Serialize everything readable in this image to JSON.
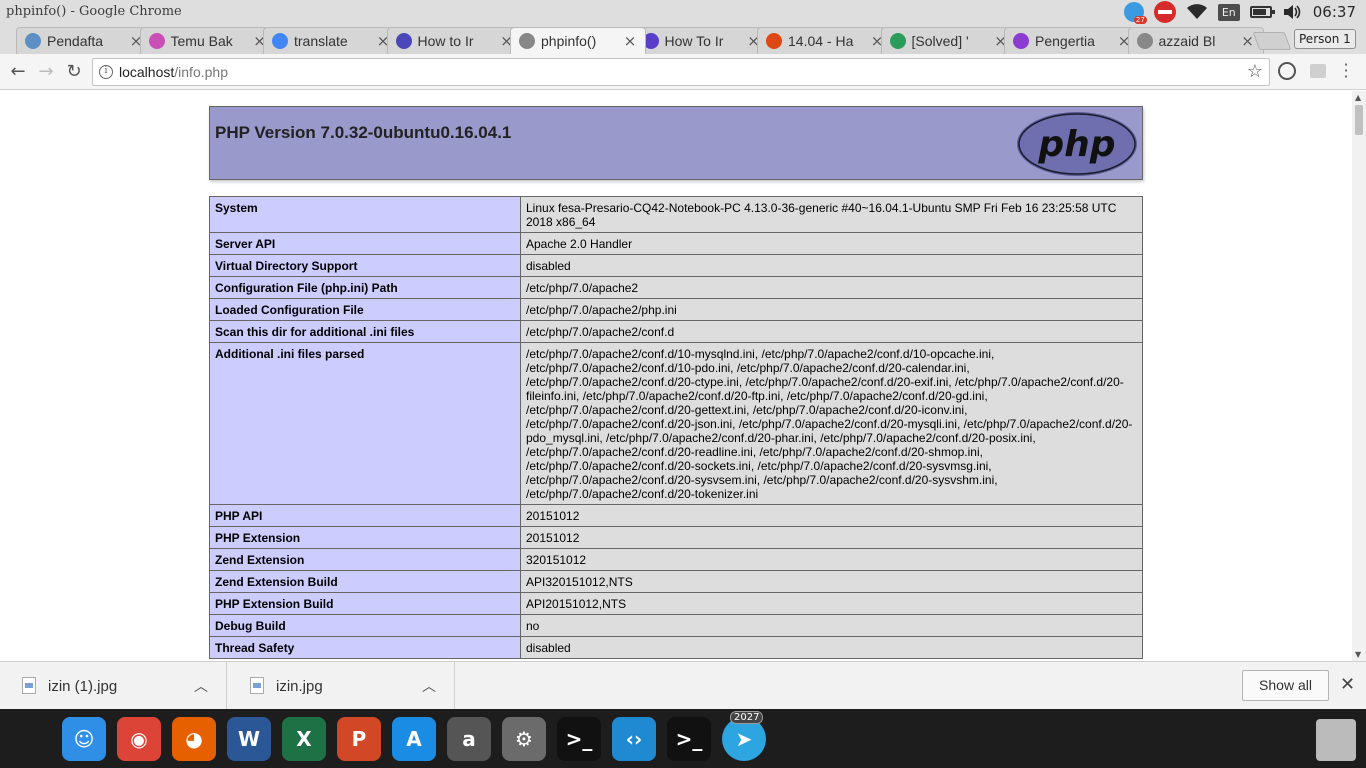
{
  "window": {
    "title": "phpinfo() - Google Chrome"
  },
  "tray": {
    "notification_count": "27",
    "language": "En",
    "battery_level": 0.8,
    "clock": "06:37"
  },
  "tabs": [
    {
      "label": "Pendafta",
      "icon": "chart-icon",
      "color": "#5c8fc4",
      "active": false
    },
    {
      "label": "Temu Bak",
      "icon": "temu-icon",
      "color": "#c94fb6",
      "active": false
    },
    {
      "label": "translate",
      "icon": "google-icon",
      "color": "#4285f4",
      "active": false
    },
    {
      "label": "How to Ir",
      "icon": "circle-icon",
      "color": "#4b47b8",
      "active": false
    },
    {
      "label": "phpinfo()",
      "icon": "page-icon",
      "color": "#888888",
      "active": true
    },
    {
      "label": "How To Ir",
      "icon": "ring-icon",
      "color": "#5a3dc8",
      "active": false
    },
    {
      "label": "14.04 - Ha",
      "icon": "askubuntu-icon",
      "color": "#dd4814",
      "active": false
    },
    {
      "label": "[Solved] '",
      "icon": "gear-icon",
      "color": "#2a9d5a",
      "active": false
    },
    {
      "label": "Pengertia",
      "icon": "swirl-icon",
      "color": "#8a3bd1",
      "active": false
    },
    {
      "label": "azzaid Bl",
      "icon": "page-icon",
      "color": "#888888",
      "active": false
    }
  ],
  "person_label": "Person 1",
  "omnibox": {
    "host": "localhost",
    "path": "/info.php"
  },
  "php": {
    "version_title": "PHP Version 7.0.32-0ubuntu0.16.04.1",
    "logo_text": "php",
    "rows": [
      {
        "key": "System",
        "value": "Linux fesa-Presario-CQ42-Notebook-PC 4.13.0-36-generic #40~16.04.1-Ubuntu SMP Fri Feb 16 23:25:58 UTC 2018 x86_64"
      },
      {
        "key": "Server API",
        "value": "Apache 2.0 Handler"
      },
      {
        "key": "Virtual Directory Support",
        "value": "disabled"
      },
      {
        "key": "Configuration File (php.ini) Path",
        "value": "/etc/php/7.0/apache2"
      },
      {
        "key": "Loaded Configuration File",
        "value": "/etc/php/7.0/apache2/php.ini"
      },
      {
        "key": "Scan this dir for additional .ini files",
        "value": "/etc/php/7.0/apache2/conf.d"
      },
      {
        "key": "Additional .ini files parsed",
        "value": "/etc/php/7.0/apache2/conf.d/10-mysqlnd.ini, /etc/php/7.0/apache2/conf.d/10-opcache.ini, /etc/php/7.0/apache2/conf.d/10-pdo.ini, /etc/php/7.0/apache2/conf.d/20-calendar.ini, /etc/php/7.0/apache2/conf.d/20-ctype.ini, /etc/php/7.0/apache2/conf.d/20-exif.ini, /etc/php/7.0/apache2/conf.d/20-fileinfo.ini, /etc/php/7.0/apache2/conf.d/20-ftp.ini, /etc/php/7.0/apache2/conf.d/20-gd.ini, /etc/php/7.0/apache2/conf.d/20-gettext.ini, /etc/php/7.0/apache2/conf.d/20-iconv.ini, /etc/php/7.0/apache2/conf.d/20-json.ini, /etc/php/7.0/apache2/conf.d/20-mysqli.ini, /etc/php/7.0/apache2/conf.d/20-pdo_mysql.ini, /etc/php/7.0/apache2/conf.d/20-phar.ini, /etc/php/7.0/apache2/conf.d/20-posix.ini, /etc/php/7.0/apache2/conf.d/20-readline.ini, /etc/php/7.0/apache2/conf.d/20-shmop.ini, /etc/php/7.0/apache2/conf.d/20-sockets.ini, /etc/php/7.0/apache2/conf.d/20-sysvmsg.ini, /etc/php/7.0/apache2/conf.d/20-sysvsem.ini, /etc/php/7.0/apache2/conf.d/20-sysvshm.ini, /etc/php/7.0/apache2/conf.d/20-tokenizer.ini"
      },
      {
        "key": "PHP API",
        "value": "20151012"
      },
      {
        "key": "PHP Extension",
        "value": "20151012"
      },
      {
        "key": "Zend Extension",
        "value": "320151012"
      },
      {
        "key": "Zend Extension Build",
        "value": "API320151012,NTS"
      },
      {
        "key": "PHP Extension Build",
        "value": "API20151012,NTS"
      },
      {
        "key": "Debug Build",
        "value": "no"
      },
      {
        "key": "Thread Safety",
        "value": "disabled"
      }
    ]
  },
  "downloads": {
    "items": [
      {
        "name": "izin (1).jpg"
      },
      {
        "name": "izin.jpg"
      }
    ],
    "show_all_label": "Show all"
  },
  "dock": {
    "apps": [
      {
        "name": "apple-logo-icon",
        "color": "#1d1d1d",
        "glyph": ""
      },
      {
        "name": "finder-icon",
        "color": "#2f8fe6",
        "glyph": "☺"
      },
      {
        "name": "chrome-icon",
        "color": "#db4437",
        "glyph": "◉"
      },
      {
        "name": "firefox-icon",
        "color": "#e66000",
        "glyph": "◕"
      },
      {
        "name": "word-icon",
        "color": "#2b5797",
        "glyph": "W"
      },
      {
        "name": "excel-icon",
        "color": "#1e7145",
        "glyph": "X"
      },
      {
        "name": "powerpoint-icon",
        "color": "#d24726",
        "glyph": "P"
      },
      {
        "name": "app-store-icon",
        "color": "#1b8ce3",
        "glyph": "A"
      },
      {
        "name": "amazon-icon",
        "color": "#555555",
        "glyph": "a"
      },
      {
        "name": "settings-icon",
        "color": "#6b6b6b",
        "glyph": "⚙"
      },
      {
        "name": "terminal-icon",
        "color": "#111111",
        "glyph": ">_"
      },
      {
        "name": "vscode-icon",
        "color": "#1f8ad2",
        "glyph": "‹›"
      },
      {
        "name": "terminal-2-icon",
        "color": "#111111",
        "glyph": ">_"
      },
      {
        "name": "telegram-icon",
        "color": "#2ca5e0",
        "glyph": "➤"
      }
    ],
    "telegram_badge": "2027"
  }
}
